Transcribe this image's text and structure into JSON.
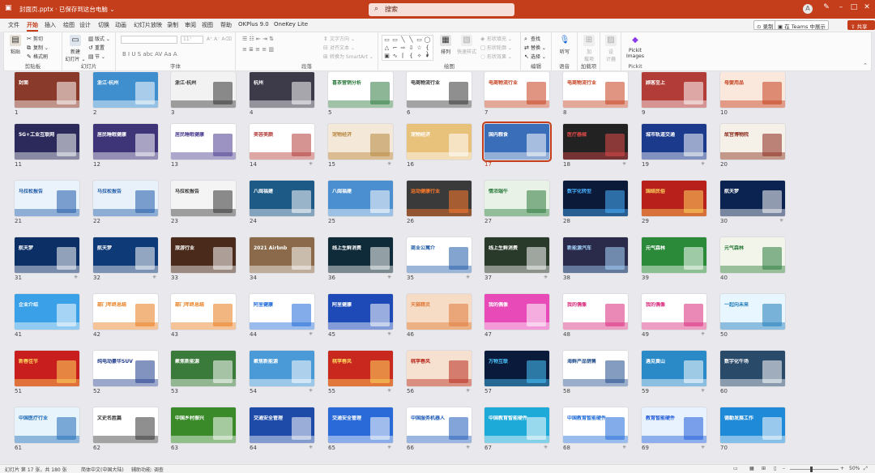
{
  "titlebar": {
    "file": "封面页.pptx · 已保存到这台电脑 ⌄",
    "search": "搜索",
    "avatar": "A"
  },
  "tabs": [
    "文件",
    "开始",
    "插入",
    "绘图",
    "设计",
    "切换",
    "动画",
    "幻灯片放映",
    "录制",
    "审阅",
    "视图",
    "帮助",
    "OKPlus 9.0",
    "OneKey Lite"
  ],
  "active_tab": 1,
  "right_buttons": {
    "record": "⊙ 录制",
    "teams": "▣ 在 Teams 中展示",
    "share": "⇪ 共享 ⌄"
  },
  "ribbon": {
    "clipboard": {
      "paste": "粘贴",
      "cut": "剪切",
      "copy": "复制 ⌄",
      "format_painter": "格式刷",
      "label": "剪贴板"
    },
    "slides": {
      "new": "新建\n幻灯片 ⌄",
      "layout": "版式 ⌄",
      "reset": "重置",
      "section": "节 ⌄",
      "label": "幻灯片"
    },
    "font": {
      "size": "11⁺",
      "format": "B  I  U  S  abc  AV  Aa  A",
      "grow": "A⁺ A⁻ A⌫",
      "label": "字体"
    },
    "paragraph": {
      "dir": "文字方向 ⌄",
      "align": "对齐文本 ⌄",
      "smartart": "转换为 SmartArt ⌄",
      "label": "段落"
    },
    "drawing": {
      "arrange": "排列",
      "quickstyle": "快速样式",
      "fill": "形状填充 ⌄",
      "outline": "形状轮廓 ⌄",
      "effect": "形状效果 ⌄",
      "label": "绘图"
    },
    "editing": {
      "find": "查找",
      "replace": "替换 ⌄",
      "select": "选择 ⌄",
      "label": "编辑"
    },
    "voice": {
      "dictate": "听写",
      "label": "语音"
    },
    "addins": {
      "addins": "加\n载项",
      "label": "加载项"
    },
    "designer": {
      "designer": "设\n计器"
    },
    "pickit": {
      "label1": "Pickit\nImages",
      "label": "Pickit"
    }
  },
  "slides": [
    {
      "n": "1",
      "t": "封面",
      "bg": "#8a3a2a",
      "fg": "#ffffff"
    },
    {
      "n": "2",
      "t": "浙江·杭州",
      "bg": "#3f8fce",
      "fg": "#ffffff"
    },
    {
      "n": "3",
      "t": "浙江·杭州",
      "bg": "#f2f2f2",
      "fg": "#333333"
    },
    {
      "n": "4",
      "t": "杭州",
      "bg": "#3d3a4a",
      "fg": "#ffffff"
    },
    {
      "n": "5",
      "t": "喜茶营销分析",
      "bg": "#ffffff",
      "fg": "#2d7a3e"
    },
    {
      "n": "6",
      "t": "电商物流行业",
      "bg": "#ffffff",
      "fg": "#333333"
    },
    {
      "n": "7",
      "t": "电商物流行业",
      "bg": "#ffffff",
      "fg": "#c43e1c"
    },
    {
      "n": "8",
      "t": "电商物流行业",
      "bg": "#ffffff",
      "fg": "#c43e1c"
    },
    {
      "n": "9",
      "t": "顾客至上",
      "bg": "#b23c38",
      "fg": "#ffffff"
    },
    {
      "n": "10",
      "t": "母婴用品",
      "bg": "#fbe8dd",
      "fg": "#c43e1c"
    },
    {
      "n": "11",
      "t": "5G+工业互联网",
      "bg": "#2c2a5a",
      "fg": "#ffffff"
    },
    {
      "n": "12",
      "t": "居民睡眠健康",
      "bg": "#3e3478",
      "fg": "#ffffff"
    },
    {
      "n": "13",
      "t": "居民睡眠健康",
      "bg": "#ffffff",
      "fg": "#4b3b8f"
    },
    {
      "n": "14",
      "t": "美容美颜",
      "bg": "#ffffff",
      "fg": "#b23c38"
    },
    {
      "n": "15",
      "t": "宠物经济",
      "bg": "#f4e8d8",
      "fg": "#b7873f"
    },
    {
      "n": "16",
      "t": "宠物经济",
      "bg": "#e8c27a",
      "fg": "#ffffff"
    },
    {
      "n": "17",
      "t": "国内粮食",
      "bg": "#3b6eb8",
      "fg": "#ffffff",
      "sel": true
    },
    {
      "n": "18",
      "t": "医疗器械",
      "bg": "#222222",
      "fg": "#e04a4a"
    },
    {
      "n": "19",
      "t": "城市轨道交通",
      "bg": "#1c3a8c",
      "fg": "#ffffff"
    },
    {
      "n": "20",
      "t": "故宫博物院",
      "bg": "#f5f0e8",
      "fg": "#8a2a1a"
    },
    {
      "n": "21",
      "t": "马拉松报告",
      "bg": "#eaf2fb",
      "fg": "#1e5aa8"
    },
    {
      "n": "22",
      "t": "马拉松报告",
      "bg": "#e8f0fa",
      "fg": "#1e5aa8"
    },
    {
      "n": "23",
      "t": "马拉松报告",
      "bg": "#f4f4f4",
      "fg": "#333333"
    },
    {
      "n": "24",
      "t": "八闽福建",
      "bg": "#1e5a86",
      "fg": "#ffffff"
    },
    {
      "n": "25",
      "t": "八闽福建",
      "bg": "#4c8fd0",
      "fg": "#ffffff"
    },
    {
      "n": "26",
      "t": "运动健康行业",
      "bg": "#3a3a3a",
      "fg": "#ff7a2a"
    },
    {
      "n": "27",
      "t": "情浓端午",
      "bg": "#e8f2e6",
      "fg": "#2c7a3c"
    },
    {
      "n": "28",
      "t": "数字化转型",
      "bg": "#0c1a3a",
      "fg": "#4ab4ff"
    },
    {
      "n": "29",
      "t": "国结民俗",
      "bg": "#b8201c",
      "fg": "#ffd860"
    },
    {
      "n": "30",
      "t": "航天梦",
      "bg": "#0a2350",
      "fg": "#ffffff"
    },
    {
      "n": "31",
      "t": "航天梦",
      "bg": "#0c2f66",
      "fg": "#ffffff"
    },
    {
      "n": "32",
      "t": "航天梦",
      "bg": "#0f3a78",
      "fg": "#ffffff"
    },
    {
      "n": "33",
      "t": "旅游行业",
      "bg": "#4a2a1a",
      "fg": "#ffffff"
    },
    {
      "n": "34",
      "t": "2021 Airbnb",
      "bg": "#8a6a4a",
      "fg": "#ffffff"
    },
    {
      "n": "36",
      "t": "线上生鲜消费",
      "bg": "#0f2a38",
      "fg": "#ffffff"
    },
    {
      "n": "35",
      "t": "商业公寓介",
      "bg": "#ffffff",
      "fg": "#1e5aa8"
    },
    {
      "n": "37",
      "t": "线上生鲜消费",
      "bg": "#2a3a2a",
      "fg": "#ffffff"
    },
    {
      "n": "38",
      "t": "新能源汽车",
      "bg": "#2a2a4a",
      "fg": "#a8d8ff"
    },
    {
      "n": "39",
      "t": "元气森林",
      "bg": "#2a8a3a",
      "fg": "#ffffff"
    },
    {
      "n": "40",
      "t": "元气森林",
      "bg": "#f2f6ea",
      "fg": "#2a7a3a"
    },
    {
      "n": "41",
      "t": "企业介绍",
      "bg": "#3aa0e8",
      "fg": "#ffffff"
    },
    {
      "n": "42",
      "t": "部门年终总结",
      "bg": "#ffffff",
      "fg": "#e87a1a"
    },
    {
      "n": "43",
      "t": "部门年终总结",
      "bg": "#ffffff",
      "fg": "#e87a1a"
    },
    {
      "n": "44",
      "t": "阿里健康",
      "bg": "#ffffff",
      "fg": "#1e6ad8"
    },
    {
      "n": "45",
      "t": "阿里健康",
      "bg": "#1e4ab8",
      "fg": "#ffffff"
    },
    {
      "n": "46",
      "t": "天猫精灵",
      "bg": "#f6dcc4",
      "fg": "#e07a3a"
    },
    {
      "n": "47",
      "t": "我的偶像",
      "bg": "#e84ab8",
      "fg": "#ffffff"
    },
    {
      "n": "48",
      "t": "我的偶像",
      "bg": "#ffffff",
      "fg": "#d8287a"
    },
    {
      "n": "49",
      "t": "我的偶像",
      "bg": "#ffffff",
      "fg": "#d8287a"
    },
    {
      "n": "50",
      "t": "一起向未来",
      "bg": "#e8f6ff",
      "fg": "#1e7ab8"
    },
    {
      "n": "51",
      "t": "新春佳节",
      "bg": "#c81e1e",
      "fg": "#ffd860"
    },
    {
      "n": "52",
      "t": "纯电动豪华SUV",
      "bg": "#ffffff",
      "fg": "#1e3a8a"
    },
    {
      "n": "53",
      "t": "聚焦新能源",
      "bg": "#3a7a3a",
      "fg": "#ffffff"
    },
    {
      "n": "54",
      "t": "聚焦新能源",
      "bg": "#4a9ad8",
      "fg": "#ffffff"
    },
    {
      "n": "55",
      "t": "桃李春风",
      "bg": "#c8281e",
      "fg": "#ffd860"
    },
    {
      "n": "56",
      "t": "桃李春风",
      "bg": "#f6e0d0",
      "fg": "#b82a1e"
    },
    {
      "n": "57",
      "t": "万物互联",
      "bg": "#0a1a3a",
      "fg": "#4ac8ff"
    },
    {
      "n": "58",
      "t": "海鲜产品销售",
      "bg": "#ffffff",
      "fg": "#1e4a8a"
    },
    {
      "n": "59",
      "t": "遇见黄山",
      "bg": "#2a8ac8",
      "fg": "#ffffff"
    },
    {
      "n": "60",
      "t": "数字化牛场",
      "bg": "#2a4a6a",
      "fg": "#ffffff"
    },
    {
      "n": "61",
      "t": "中国医疗行业",
      "bg": "#e8f4fb",
      "fg": "#1e6ab8"
    },
    {
      "n": "62",
      "t": "文史名胜篇",
      "bg": "#ffffff",
      "fg": "#333333"
    },
    {
      "n": "63",
      "t": "中国乡村振兴",
      "bg": "#3a8a2a",
      "fg": "#ffffff"
    },
    {
      "n": "64",
      "t": "交通安全管理",
      "bg": "#1e4aa8",
      "fg": "#ffffff"
    },
    {
      "n": "65",
      "t": "交通安全管理",
      "bg": "#2a6ad8",
      "fg": "#ffffff"
    },
    {
      "n": "66",
      "t": "中国服务机器人",
      "bg": "#ffffff",
      "fg": "#1e5ab8"
    },
    {
      "n": "67",
      "t": "中国教育智能硬件",
      "bg": "#1eaad8",
      "fg": "#ffffff"
    },
    {
      "n": "68",
      "t": "中国教育智能硬件",
      "bg": "#ffffff",
      "fg": "#1e6ad8"
    },
    {
      "n": "69",
      "t": "教育智能硬件",
      "bg": "#e8f2ff",
      "fg": "#1e5ad8"
    },
    {
      "n": "70",
      "t": "德勤发展工作",
      "bg": "#1e8ad8",
      "fg": "#ffffff"
    }
  ],
  "stars": [
    "14",
    "15",
    "18",
    "19",
    "30",
    "31",
    "32",
    "35",
    "36",
    "37",
    "44",
    "45",
    "49",
    "54",
    "55",
    "56",
    "59",
    "64",
    "65",
    "66",
    "67",
    "68",
    "69"
  ],
  "status": {
    "slide": "幻灯片 第 17 张，共 180 张",
    "lang": "简体中文(中国大陆)",
    "access": "辅助功能: 调查",
    "zoom": "50%"
  }
}
